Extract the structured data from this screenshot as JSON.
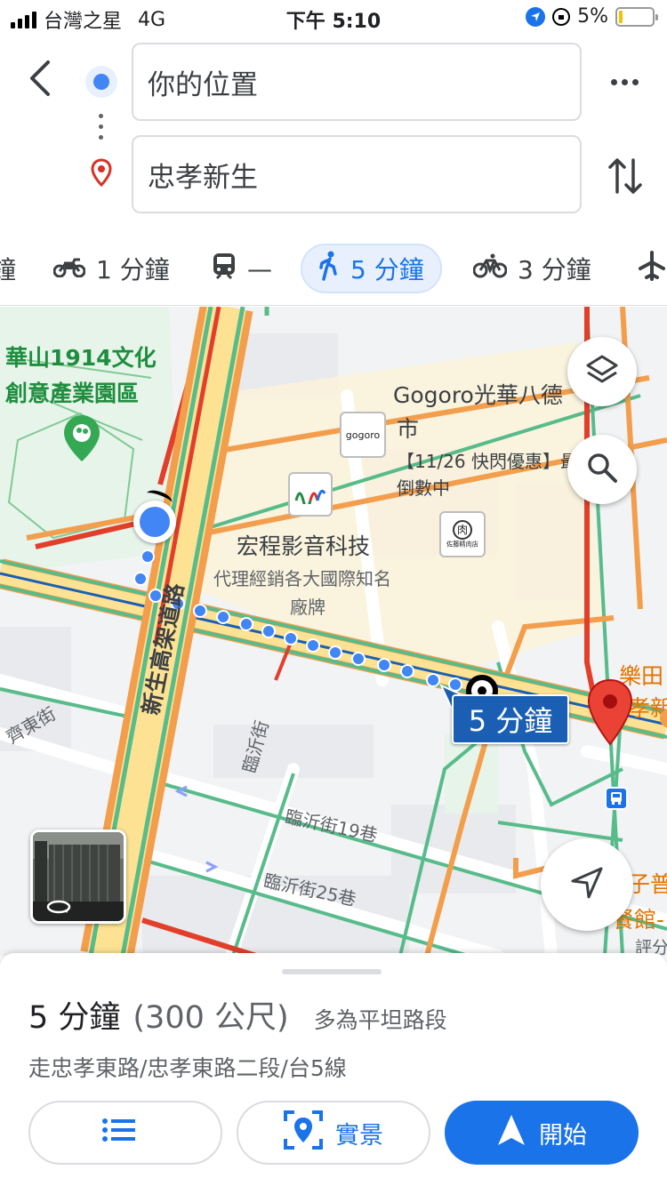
{
  "status_bar": {
    "carrier": "台灣之星",
    "network": "4G",
    "time": "下午 5:10",
    "battery": "5%"
  },
  "search": {
    "origin": "你的位置",
    "destination": "忠孝新生"
  },
  "modes": [
    {
      "label": "鐘",
      "icon": "car-icon"
    },
    {
      "label": "1 分鐘",
      "icon": "motorcycle-icon"
    },
    {
      "label": "—",
      "icon": "train-icon"
    },
    {
      "label": "5 分鐘",
      "icon": "walk-icon",
      "selected": true
    },
    {
      "label": "3 分鐘",
      "icon": "bicycle-icon"
    },
    {
      "label": "",
      "icon": "flight-icon"
    }
  ],
  "map": {
    "labels": {
      "huashan": "華山1914文化",
      "huashan2": "創意產業園區",
      "gogoro": "Gogoro光華八德",
      "gogoro2": "市",
      "gogoro_promo": "【11/26 快閃優惠】最",
      "gogoro_promo2": "倒數中",
      "gogoro_logo": "gogoro",
      "shop_logo": "佐藤精肉店",
      "hongcheng": "宏程影音科技",
      "hongcheng_desc": "代理經銷各大國際知名",
      "hongcheng_desc2": "廠牌",
      "xinsheng": "新生高架道路",
      "qidong": "齊東街",
      "linyi": "臨沂街",
      "linyi19": "臨沂街19巷",
      "linyi25": "臨沂街25巷",
      "letian": "樂田",
      "letian2": "孝新",
      "right_a": "子普",
      "right_b": "餐館-",
      "right_c": "評分"
    },
    "eta_bubble": "5 分鐘"
  },
  "sheet": {
    "duration": "5 分鐘",
    "distance": "(300 公尺)",
    "note": "多為平坦路段",
    "via": "走忠孝東路/忠孝東路二段/台5線",
    "buttons": {
      "steps": "",
      "live_view": "實景",
      "start": "開始"
    }
  },
  "colors": {
    "accent": "#1a73e8",
    "route_dot": "#4285f4",
    "pin": "#ea4335"
  }
}
